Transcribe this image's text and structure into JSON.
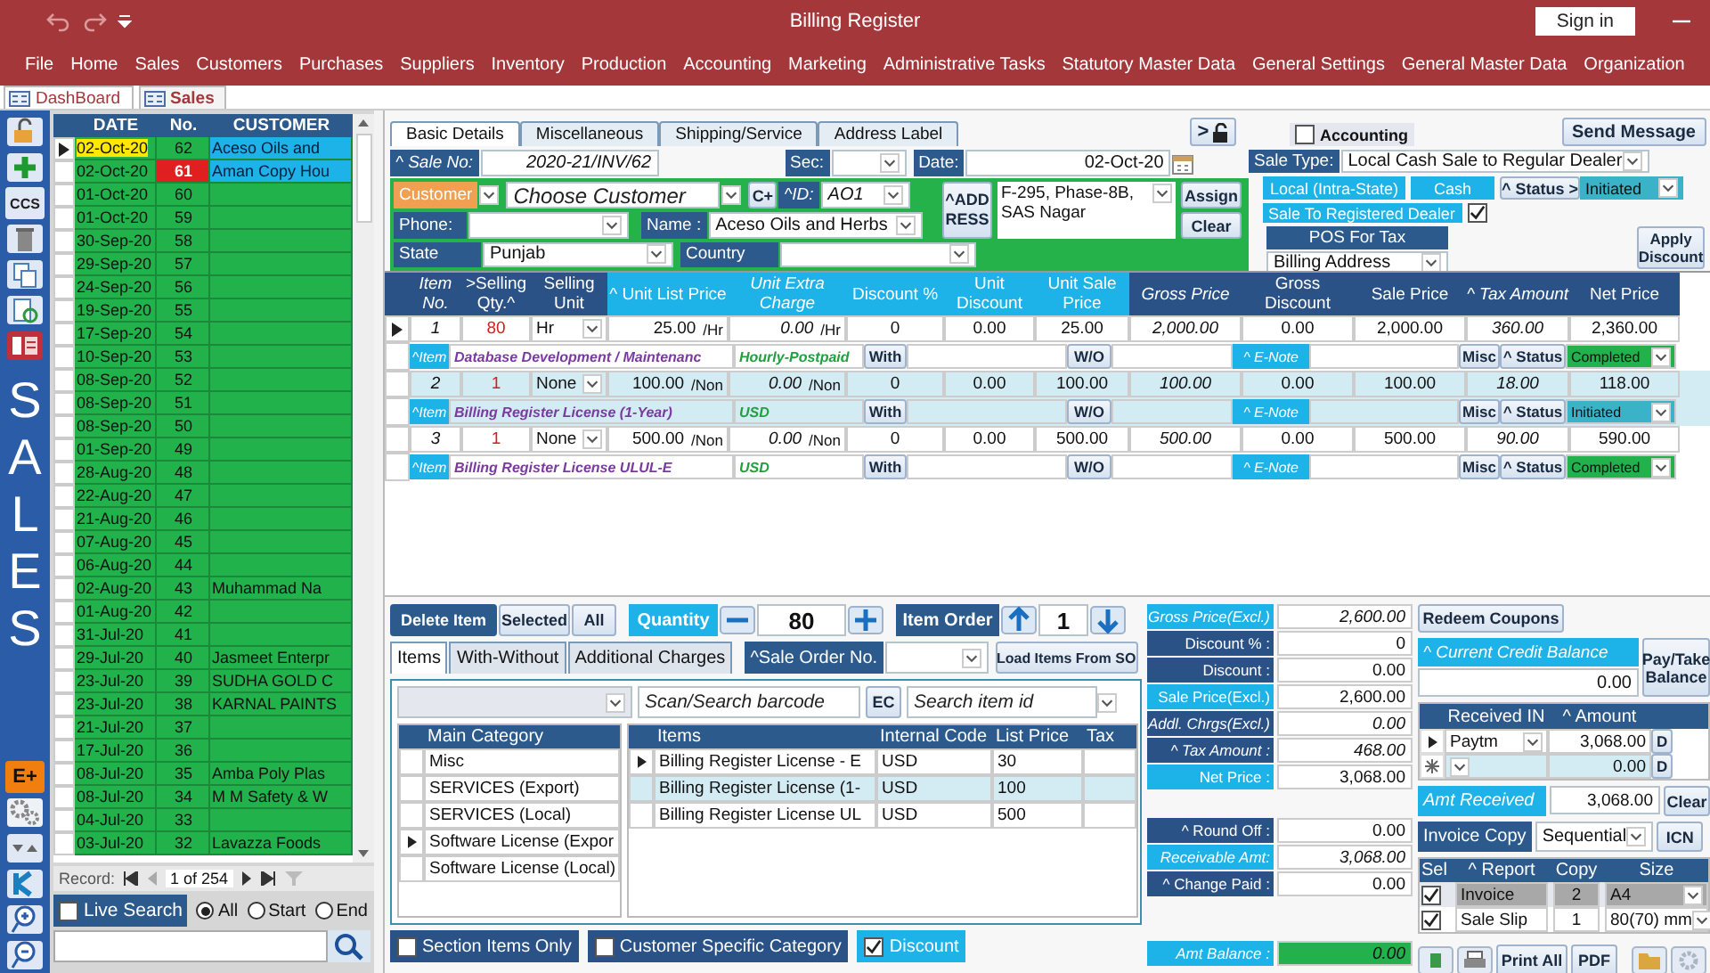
{
  "window": {
    "title": "Billing Register",
    "sign_in": "Sign in"
  },
  "menu": [
    "File",
    "Home",
    "Sales",
    "Customers",
    "Purchases",
    "Suppliers",
    "Inventory",
    "Production",
    "Accounting",
    "Marketing",
    "Administrative Tasks",
    "Statutory Master Data",
    "General Settings",
    "General Master Data",
    "Organization"
  ],
  "doc_tabs": [
    {
      "label": "DashBoard",
      "selected": false
    },
    {
      "label": "Sales",
      "selected": true
    }
  ],
  "side_toolbar": {
    "ccs": "CCS",
    "title": "SALES",
    "e_plus": "E+"
  },
  "records": {
    "columns": [
      "DATE",
      "No.",
      "CUSTOMER"
    ],
    "rows": [
      {
        "date": "02-Oct-20",
        "no": "62",
        "customer": "Aceso Oils and",
        "selected": true,
        "kind": "current"
      },
      {
        "date": "02-Oct-20",
        "no": "61",
        "customer": "Aman Copy Hou",
        "selected": false,
        "kind": "flagged"
      },
      {
        "date": "01-Oct-20",
        "no": "60",
        "selected": false,
        "kind": "normal"
      },
      {
        "date": "01-Oct-20",
        "no": "59",
        "selected": false,
        "kind": "normal"
      },
      {
        "date": "30-Sep-20",
        "no": "58",
        "selected": false,
        "kind": "normal"
      },
      {
        "date": "29-Sep-20",
        "no": "57",
        "selected": false,
        "kind": "normal"
      },
      {
        "date": "24-Sep-20",
        "no": "56",
        "selected": false,
        "kind": "normal"
      },
      {
        "date": "19-Sep-20",
        "no": "55",
        "selected": false,
        "kind": "normal"
      },
      {
        "date": "17-Sep-20",
        "no": "54",
        "selected": false,
        "kind": "normal"
      },
      {
        "date": "10-Sep-20",
        "no": "53",
        "selected": false,
        "kind": "normal"
      },
      {
        "date": "08-Sep-20",
        "no": "52",
        "selected": false,
        "kind": "normal"
      },
      {
        "date": "08-Sep-20",
        "no": "51",
        "selected": false,
        "kind": "normal"
      },
      {
        "date": "08-Sep-20",
        "no": "50",
        "selected": false,
        "kind": "normal"
      },
      {
        "date": "01-Sep-20",
        "no": "49",
        "selected": false,
        "kind": "normal"
      },
      {
        "date": "28-Aug-20",
        "no": "48",
        "selected": false,
        "kind": "normal"
      },
      {
        "date": "22-Aug-20",
        "no": "47",
        "selected": false,
        "kind": "normal"
      },
      {
        "date": "21-Aug-20",
        "no": "46",
        "selected": false,
        "kind": "normal"
      },
      {
        "date": "07-Aug-20",
        "no": "45",
        "selected": false,
        "kind": "normal"
      },
      {
        "date": "06-Aug-20",
        "no": "44",
        "selected": false,
        "kind": "normal"
      },
      {
        "date": "02-Aug-20",
        "no": "43",
        "customer": "Muhammad Na",
        "selected": false,
        "kind": "normal"
      },
      {
        "date": "01-Aug-20",
        "no": "42",
        "selected": false,
        "kind": "normal"
      },
      {
        "date": "31-Jul-20",
        "no": "41",
        "selected": false,
        "kind": "normal"
      },
      {
        "date": "29-Jul-20",
        "no": "40",
        "customer": "Jasmeet Enterpr",
        "selected": false,
        "kind": "normal"
      },
      {
        "date": "23-Jul-20",
        "no": "39",
        "customer": "SUDHA GOLD C",
        "selected": false,
        "kind": "normal"
      },
      {
        "date": "23-Jul-20",
        "no": "38",
        "customer": "KARNAL PAINTS",
        "selected": false,
        "kind": "normal"
      },
      {
        "date": "21-Jul-20",
        "no": "37",
        "selected": false,
        "kind": "normal"
      },
      {
        "date": "17-Jul-20",
        "no": "36",
        "selected": false,
        "kind": "normal"
      },
      {
        "date": "08-Jul-20",
        "no": "35",
        "customer": "Amba Poly Plas",
        "selected": false,
        "kind": "normal"
      },
      {
        "date": "08-Jul-20",
        "no": "34",
        "customer": "M M Safety & W",
        "selected": false,
        "kind": "normal"
      },
      {
        "date": "04-Jul-20",
        "no": "33",
        "selected": false,
        "kind": "normal"
      },
      {
        "date": "03-Jul-20",
        "no": "32",
        "customer": "Lavazza Foods",
        "selected": false,
        "kind": "normal"
      }
    ],
    "record_label": "Record:",
    "position": "1 of 254",
    "live_search": {
      "label": "Live Search",
      "checked": false
    },
    "match_options": [
      {
        "label": "All",
        "selected": true
      },
      {
        "label": "Start",
        "selected": false
      },
      {
        "label": "End",
        "selected": false
      }
    ]
  },
  "form_tabs": [
    {
      "label": "Basic Details",
      "selected": true
    },
    {
      "label": "Miscellaneous",
      "selected": false
    },
    {
      "label": "Shipping/Service",
      "selected": false
    },
    {
      "label": "Address Label",
      "selected": false
    }
  ],
  "lock_button": ">",
  "accounting": {
    "label": "Accounting",
    "checked": false
  },
  "send_message": "Send Message",
  "header": {
    "sale_no_label": "^ Sale No:",
    "sale_no": "2020-21/INV/62",
    "sec_label": "Sec:",
    "date_label": "Date:",
    "date": "02-Oct-20",
    "sale_type_label": "Sale Type:",
    "sale_type": "Local Cash Sale to Regular Dealer"
  },
  "customer": {
    "type_label": "Customer",
    "placeholder": "Choose Customer",
    "add_button": "C+",
    "id_label": "^ID:",
    "id": "AO1",
    "address_button": "^ADD RESS",
    "address": "F-295, Phase-8B, SAS Nagar",
    "assign": "Assign",
    "clear": "Clear",
    "phone_label": "Phone:",
    "name_label": "Name :",
    "name": "Aceso Oils and Herbs",
    "state_label": "State",
    "state": "Punjab",
    "country_label": "Country"
  },
  "sale_info": {
    "region": "Local (Intra-State)",
    "payment": "Cash",
    "status_button": "^ Status >",
    "status": "Initiated",
    "registered": {
      "label": "Sale To Registered Dealer",
      "checked": true
    },
    "pos_label": "POS For Tax",
    "pos": "Billing Address",
    "apply_discount": "Apply Discount"
  },
  "item_columns": [
    {
      "label": "Item No.",
      "color": "#2b5287",
      "italic": true
    },
    {
      "label": ">Selling Qty.^",
      "color": "#2b5287",
      "italic": false
    },
    {
      "label": "Selling Unit",
      "color": "#2b5287",
      "italic": false
    },
    {
      "label": "^ Unit List Price",
      "color": "#1db2e8",
      "italic": false
    },
    {
      "label": "Unit Extra Charge",
      "color": "#1db2e8",
      "italic": true
    },
    {
      "label": "Discount %",
      "color": "#1db2e8",
      "italic": false
    },
    {
      "label": "Unit Discount",
      "color": "#1db2e8",
      "italic": false
    },
    {
      "label": "Unit Sale Price",
      "color": "#1db2e8",
      "italic": false
    },
    {
      "label": "Gross Price",
      "color": "#2b5287",
      "italic": true
    },
    {
      "label": "Gross Discount",
      "color": "#2b5287",
      "italic": false
    },
    {
      "label": "Sale Price",
      "color": "#2b5287",
      "italic": false
    },
    {
      "label": "^ Tax Amount",
      "color": "#2b5287",
      "italic": true
    },
    {
      "label": "Net Price",
      "color": "#2b5287",
      "italic": false
    }
  ],
  "items": [
    {
      "selected": true,
      "highlighted": false,
      "no": "1",
      "qty": "80",
      "unit": "Hr",
      "list_price": "25.00",
      "list_per": "/Hr",
      "extra": "0.00",
      "extra_per": "/Hr",
      "discount_pct": "0",
      "unit_discount": "0.00",
      "unit_sale": "25.00",
      "gross": "2,000.00",
      "gross_discount": "0.00",
      "sale": "2,000.00",
      "tax": "360.00",
      "net": "2,360.00",
      "tag": "^Item",
      "name": "Database Development / Maintenanc",
      "type": "Hourly-Postpaid",
      "with": "With",
      "without": "W/O",
      "enote": "^ E-Note",
      "misc": "Misc",
      "status_button": "^ Status",
      "status": {
        "label": "Completed",
        "color": "#22b14c"
      }
    },
    {
      "selected": false,
      "highlighted": true,
      "no": "2",
      "qty": "1",
      "unit": "None",
      "list_price": "100.00",
      "list_per": "/Non",
      "extra": "0.00",
      "extra_per": "/Non",
      "discount_pct": "0",
      "unit_discount": "0.00",
      "unit_sale": "100.00",
      "gross": "100.00",
      "gross_discount": "0.00",
      "sale": "100.00",
      "tax": "18.00",
      "net": "118.00",
      "tag": "^Item",
      "name": "Billing Register License (1-Year)",
      "type": "USD",
      "with": "With",
      "without": "W/O",
      "enote": "^ E-Note",
      "misc": "Misc",
      "status_button": "^ Status",
      "status": {
        "label": "Initiated",
        "color": "#3ab3c9"
      }
    },
    {
      "selected": false,
      "highlighted": false,
      "no": "3",
      "qty": "1",
      "unit": "None",
      "list_price": "500.00",
      "list_per": "/Non",
      "extra": "0.00",
      "extra_per": "/Non",
      "discount_pct": "0",
      "unit_discount": "0.00",
      "unit_sale": "500.00",
      "gross": "500.00",
      "gross_discount": "0.00",
      "sale": "500.00",
      "tax": "90.00",
      "net": "590.00",
      "tag": "^Item",
      "name": "Billing Register License ULUL-E",
      "type": "USD",
      "with": "With",
      "without": "W/O",
      "enote": "^ E-Note",
      "misc": "Misc",
      "status_button": "^ Status",
      "status": {
        "label": "Completed",
        "color": "#22b14c"
      }
    }
  ],
  "item_actions": {
    "delete": "Delete Item",
    "selected": "Selected",
    "all": "All",
    "quantity_label": "Quantity",
    "quantity": "80",
    "order_label": "Item Order",
    "order": "1"
  },
  "lower_tabs": [
    {
      "label": "Items",
      "selected": true
    },
    {
      "label": "With-Without",
      "selected": false
    },
    {
      "label": "Additional Charges",
      "selected": false
    }
  ],
  "sale_order_label": "^Sale Order No.",
  "load_button": "Load Items From SO",
  "search": {
    "barcode_placeholder": "Scan/Search barcode",
    "ec": "EC",
    "item_placeholder": "Search item id"
  },
  "categories": {
    "title": "Main Category",
    "rows": [
      {
        "label": "Misc",
        "selected": false
      },
      {
        "label": "SERVICES (Export)",
        "selected": false
      },
      {
        "label": "SERVICES (Local)",
        "selected": false
      },
      {
        "label": "Software License (Expor",
        "selected": true
      },
      {
        "label": "Software License (Local)",
        "selected": false
      }
    ]
  },
  "catalog": {
    "columns": [
      "Items",
      "Internal Code",
      "List Price",
      "Tax"
    ],
    "rows": [
      {
        "item": "Billing Register License - E",
        "code": "USD",
        "price": "30",
        "selected": true,
        "highlighted": false
      },
      {
        "item": "Billing Register License (1-",
        "code": "USD",
        "price": "100",
        "selected": false,
        "highlighted": true
      },
      {
        "item": "Billing Register License UL",
        "code": "USD",
        "price": "500",
        "selected": false,
        "highlighted": false
      }
    ]
  },
  "filters": [
    {
      "label": "Section Items Only",
      "checked": false,
      "color": "#2b5287"
    },
    {
      "label": "Customer Specific Category",
      "checked": false,
      "color": "#2b5287"
    },
    {
      "label": "Discount",
      "checked": true,
      "color": "#1db2e8"
    }
  ],
  "totals": [
    [
      {
        "label": "Gross Price(Excl.)",
        "value": "2,600.00",
        "color": "#1db2e8",
        "italic": true,
        "highlighted": false
      },
      {
        "label": "Discount % :",
        "value": "0",
        "color": "#2b5287",
        "italic": false,
        "highlighted": false
      },
      {
        "label": "Discount :",
        "value": "0.00",
        "color": "#2b5287",
        "italic": false,
        "highlighted": false
      },
      {
        "label": "Sale Price(Excl.)",
        "value": "2,600.00",
        "color": "#1db2e8",
        "italic": false,
        "highlighted": false
      },
      {
        "label": "Addl. Chrgs(Excl.)",
        "value": "0.00",
        "color": "#2b5287",
        "italic": true,
        "highlighted": false
      },
      {
        "label": "^ Tax Amount :",
        "value": "468.00",
        "color": "#2b5287",
        "italic": true,
        "highlighted": false
      },
      {
        "label": "Net Price :",
        "value": "3,068.00",
        "color": "#1db2e8",
        "italic": false,
        "highlighted": false
      }
    ],
    [
      {
        "label": "^ Round Off :",
        "value": "0.00",
        "color": "#2b5287",
        "italic": false,
        "highlighted": false
      },
      {
        "label": "Receivable Amt:",
        "value": "3,068.00",
        "color": "#1db2e8",
        "italic": true,
        "highlighted": false
      },
      {
        "label": "^ Change Paid :",
        "value": "0.00",
        "color": "#2b5287",
        "italic": false,
        "highlighted": false
      }
    ],
    [
      {
        "label": "Amt Balance :",
        "value": "0.00",
        "color": "#1db2e8",
        "italic": true,
        "highlighted": true
      }
    ]
  ],
  "redeem": "Redeem Coupons",
  "credit": {
    "label": "^ Current Credit Balance",
    "value": "0.00"
  },
  "pay_take": "Pay/Take Balance",
  "payments": {
    "columns": [
      "Received IN",
      "^ Amount"
    ],
    "rows": [
      {
        "method": "Paytm",
        "amount": "3,068.00",
        "d": "D",
        "selected": true,
        "new": false
      },
      {
        "amount": "0.00",
        "d": "D",
        "selected": false,
        "new": true
      }
    ]
  },
  "amt_received": {
    "label": "Amt Received",
    "value": "3,068.00",
    "clear": "Clear"
  },
  "invoice_copy": {
    "label": "Invoice Copy",
    "value": "Sequential",
    "icn": "ICN"
  },
  "reports": {
    "columns": [
      "Sel",
      "^ Report",
      "Copy",
      "Size"
    ],
    "rows": [
      {
        "checked": true,
        "report": "Invoice",
        "copy": "2",
        "size": "A4",
        "highlighted": true
      },
      {
        "checked": true,
        "report": "Sale Slip",
        "copy": "1",
        "size": "80(70) mm",
        "highlighted": false
      }
    ]
  },
  "print_all": "Print All",
  "pdf": "PDF"
}
